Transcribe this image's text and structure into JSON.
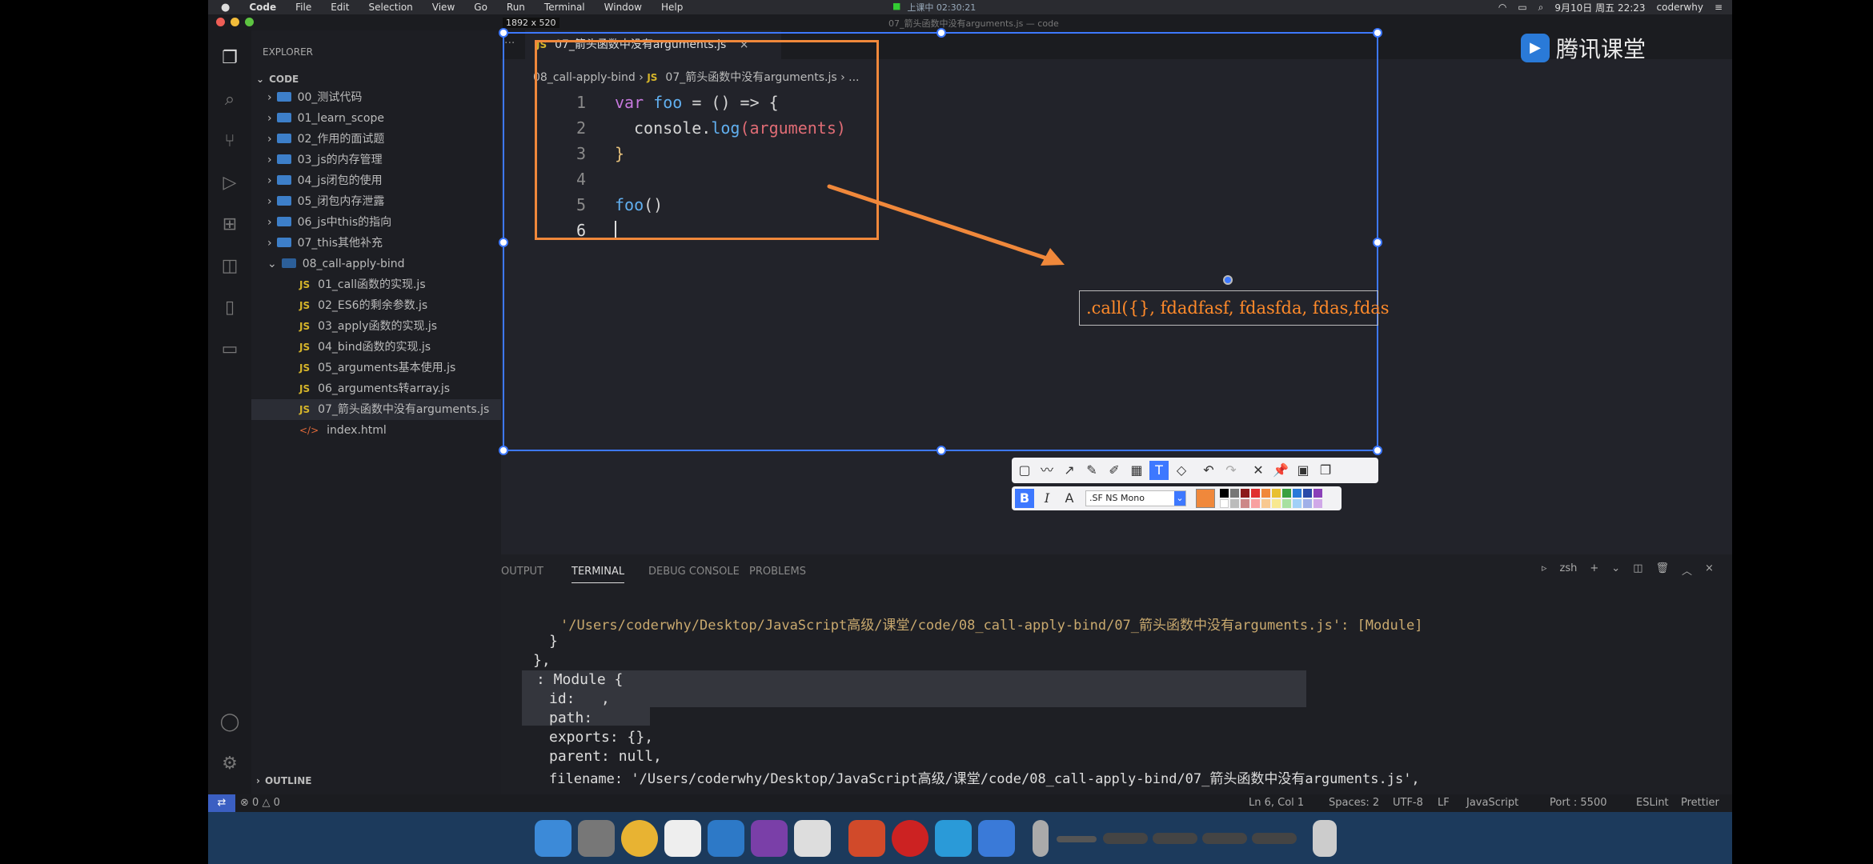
{
  "menubar": {
    "apple": "",
    "items": [
      "Code",
      "File",
      "Edit",
      "Selection",
      "View",
      "Go",
      "Run",
      "Terminal",
      "Window",
      "Help"
    ],
    "center_status": "上课中 02:30:21",
    "window_title": "07_箭头函数中没有arguments.js — code",
    "date": "9月10日 周五 22:23",
    "user": "coderwhy"
  },
  "dimension_label": "1892 x 520",
  "watermark": "腾讯课堂",
  "sidebar": {
    "title": "EXPLORER",
    "root": "CODE",
    "folders": [
      "00_测试代码",
      "01_learn_scope",
      "02_作用的面试题",
      "03_js的内存管理",
      "04_js闭包的使用",
      "05_闭包内存泄露",
      "06_js中this的指向",
      "07_this其他补充",
      "08_call-apply-bind"
    ],
    "files": [
      "01_call函数的实现.js",
      "02_ES6的剩余参数.js",
      "03_apply函数的实现.js",
      "04_bind函数的实现.js",
      "05_arguments基本使用.js",
      "06_arguments转array.js",
      "07_箭头函数中没有arguments.js"
    ],
    "html_file": "index.html",
    "outline": "OUTLINE"
  },
  "editor": {
    "tab_label": "07_箭头函数中没有arguments.js",
    "breadcrumb_folder": "08_call-apply-bind",
    "breadcrumb_file": "07_箭头函数中没有arguments.js",
    "breadcrumb_more": "...",
    "line_numbers": [
      "1",
      "2",
      "3",
      "4",
      "5",
      "6"
    ],
    "code": {
      "l1_kw": "var",
      "l1_name": "foo",
      "l1_rest": " = () => {",
      "l2_obj": "console",
      "l2_dot": ".",
      "l2_fn": "log",
      "l2_arg": "(arguments)",
      "l3": "}",
      "l5_fn": "foo",
      "l5_rest": "()"
    }
  },
  "annotation": {
    "call_text": ".call({}, fdadfasf, fdasfda, fdas,fdas",
    "font_name": ".SF NS Mono"
  },
  "panel": {
    "tabs": [
      "OUTPUT",
      "TERMINAL",
      "DEBUG CONSOLE",
      "PROBLEMS"
    ],
    "shell": "zsh",
    "lines": [
      "'/Users/coderwhy/Desktop/JavaScript高级/课堂/code/08_call-apply-bind/07_箭头函数中没有arguments.js': [Module]",
      "}",
      "},",
      ": Module {",
      "id:   ,",
      "path:",
      "exports: {},",
      "parent: null,",
      "filename: '/Users/coderwhy/Desktop/JavaScript高级/课堂/code/08_call-apply-bind/07_箭头函数中没有arguments.js',"
    ]
  },
  "status": {
    "errors": "0",
    "warnings": "0",
    "position": "Ln 6, Col 1",
    "spaces": "Spaces: 2",
    "encoding": "UTF-8",
    "eol": "LF",
    "language": "JavaScript",
    "port": "Port : 5500",
    "eslint": "ESLint",
    "prettier": "Prettier"
  },
  "colors": {
    "accent_orange": "#f0883b",
    "selection_blue": "#3d78ff",
    "keyword": "#c678dd",
    "function": "#61afef",
    "variable": "#e06c75"
  }
}
